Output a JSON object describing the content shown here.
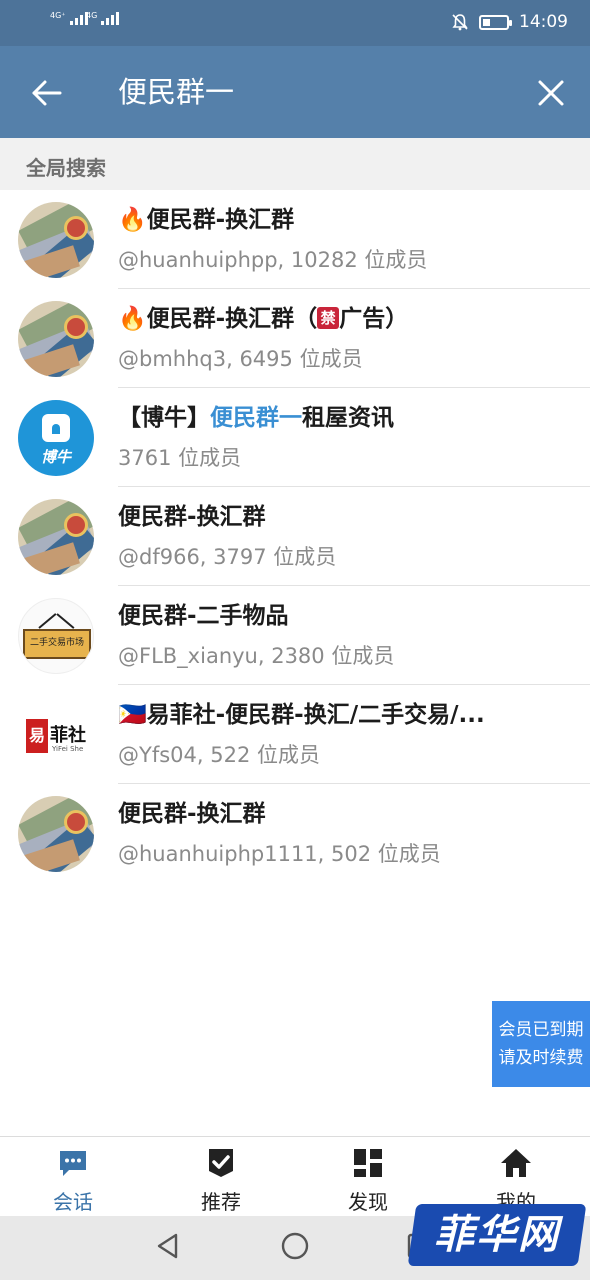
{
  "status_bar": {
    "signal1_label": "4G⁺",
    "signal2_label": "4G",
    "time": "14:09",
    "battery_level": 0.3
  },
  "header": {
    "search_query": "便民群一"
  },
  "section": {
    "label": "全局搜索"
  },
  "results": [
    {
      "prefix": "🔥",
      "highlight": "",
      "name": "便民群-换汇群",
      "meta": "@huanhuiphpp, 10282 位成员",
      "avatar": "money"
    },
    {
      "prefix": "🔥",
      "highlight": "",
      "name": "便民群-换汇群（",
      "badge": "禁",
      "suffix": "广告）",
      "meta": "@bmhhq3, 6495 位成员",
      "avatar": "money"
    },
    {
      "prefix": "【博牛】",
      "highlight": "便民群一",
      "name": "租屋资讯",
      "meta": "3761 位成员",
      "avatar": "bonew",
      "avatar_label": "博牛"
    },
    {
      "prefix": "",
      "highlight": "",
      "name": "便民群-换汇群",
      "meta": "@df966, 3797 位成员",
      "avatar": "money"
    },
    {
      "prefix": "",
      "highlight": "",
      "name": "便民群-二手物品",
      "meta": "@FLB_xianyu, 2380 位成员",
      "avatar": "market",
      "avatar_label": "二手交易市场"
    },
    {
      "prefix": "🇵🇭",
      "highlight": "",
      "name": "易菲社-便民群-换汇/二手交易/...",
      "meta": "@Yfs04, 522 位成员",
      "avatar": "yifei",
      "avatar_label": "菲社",
      "avatar_seal": "易",
      "avatar_small": "YiFei She"
    },
    {
      "prefix": "",
      "highlight": "",
      "name": "便民群-换汇群",
      "meta": "@huanhuiphp1111, 502 位成员",
      "avatar": "money"
    }
  ],
  "renew_badge": {
    "line1": "会员已到期",
    "line2": "请及时续费"
  },
  "bottom_nav": {
    "tabs": [
      {
        "label": "会话",
        "icon": "chat-bubble-icon",
        "active": true
      },
      {
        "label": "推荐",
        "icon": "shield-check-icon",
        "active": false
      },
      {
        "label": "发现",
        "icon": "grid-icon",
        "active": false
      },
      {
        "label": "我的",
        "icon": "home-icon",
        "active": false
      }
    ]
  },
  "watermark": {
    "text": "菲华网"
  },
  "colors": {
    "status_bar": "#4d7399",
    "header": "#5580aa",
    "highlight": "#3a8fd3",
    "active_tab": "#3b74a9",
    "renew_badge": "#3c8ae8"
  }
}
